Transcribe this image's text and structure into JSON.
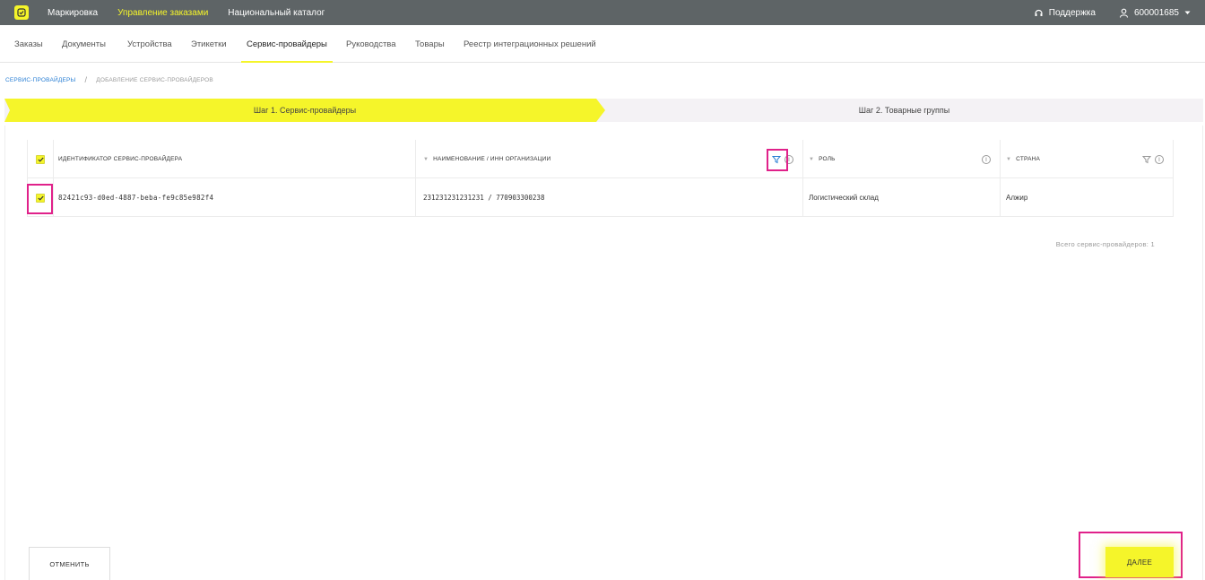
{
  "topbar": {
    "nav": [
      "Маркировка",
      "Управление заказами",
      "Национальный каталог"
    ],
    "active_index": 1,
    "support": "Поддержка",
    "user": "600001685"
  },
  "subnav": {
    "tabs": [
      "Заказы",
      "Документы",
      "Устройства",
      "Этикетки",
      "Сервис-провайдеры",
      "Руководства",
      "Товары",
      "Реестр интеграционных решений"
    ],
    "active": "Сервис-провайдеры"
  },
  "breadcrumb": {
    "link": "СЕРВИС-ПРОВАЙДЕРЫ",
    "separator": "/",
    "current": "ДОБАВЛЕНИЕ СЕРВИС-ПРОВАЙДЕРОВ"
  },
  "steps": {
    "step1": "Шаг 1. Сервис-провайдеры",
    "step2": "Шаг 2. Товарные группы"
  },
  "table": {
    "columns": [
      "ИДЕНТИФИКАТОР СЕРВИС-ПРОВАЙДЕРА",
      "НАИМЕНОВАНИЕ / ИНН ОРГАНИЗАЦИИ",
      "РОЛЬ",
      "СТРАНА"
    ],
    "rows": [
      {
        "id": "82421c93-d0ed-4887-beba-fe9c85e982f4",
        "name_inn": "231231231231231 / 7709033002З8",
        "role": "Логистический склад",
        "country": "Алжир",
        "checked": true
      }
    ],
    "total": "Всего сервис-провайдеров: 1"
  },
  "buttons": {
    "cancel": "ОТМЕНИТЬ",
    "next": "ДАЛЕЕ"
  },
  "colors": {
    "accent": "#f5f52a",
    "highlight": "#e0218a",
    "topbar": "#5e6466",
    "link": "#2a7fd4"
  }
}
